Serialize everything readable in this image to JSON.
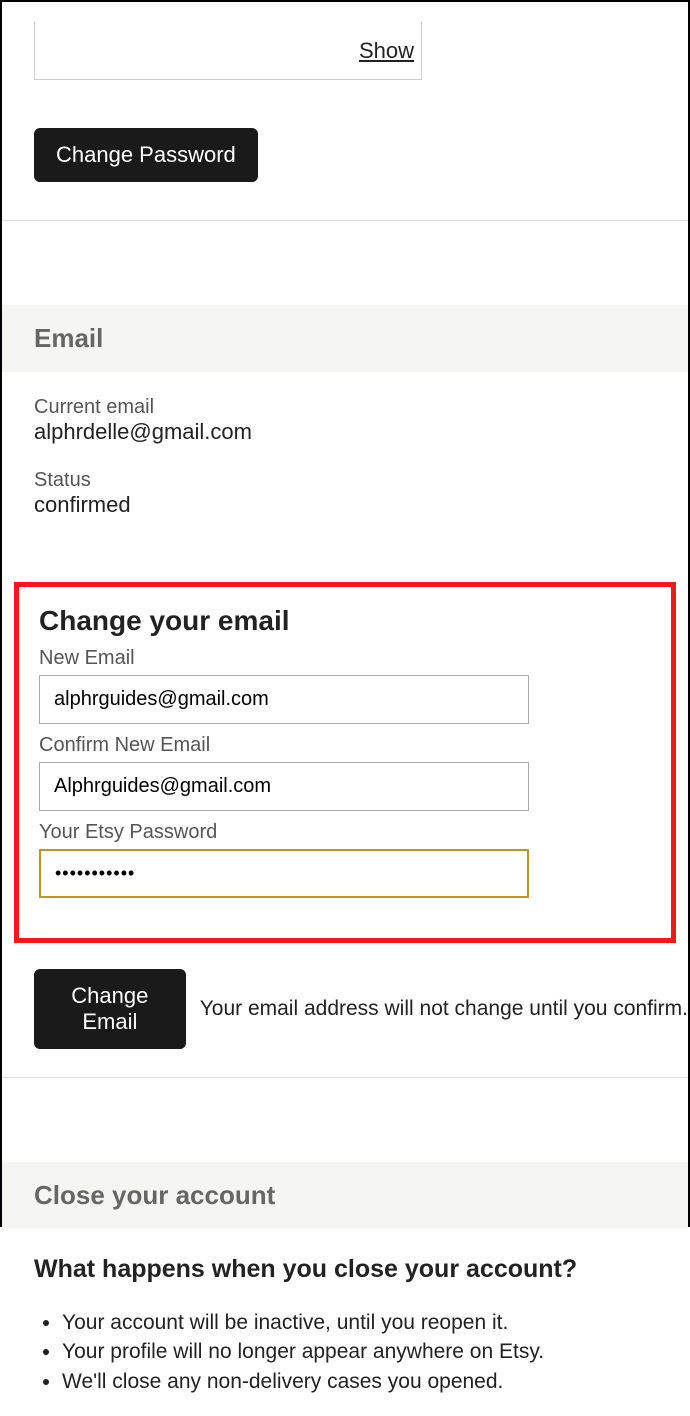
{
  "password_section": {
    "show_link": "Show",
    "change_button": "Change Password"
  },
  "email_section": {
    "header": "Email",
    "current_email_label": "Current email",
    "current_email_value": "alphrdelle@gmail.com",
    "status_label": "Status",
    "status_value": "confirmed",
    "change_title": "Change your email",
    "new_email_label": "New Email",
    "new_email_value": "alphrguides@gmail.com",
    "confirm_email_label": "Confirm New Email",
    "confirm_email_value": "Alphrguides@gmail.com",
    "etsy_password_label": "Your Etsy Password",
    "etsy_password_value": "•••••••••••",
    "change_email_button": "Change Email",
    "change_email_note": "Your email address will not change until you confirm."
  },
  "close_section": {
    "header": "Close your account",
    "subtitle": "What happens when you close your account?",
    "bullets": [
      "Your account will be inactive, until you reopen it.",
      "Your profile will no longer appear anywhere on Etsy.",
      "We'll close any non-delivery cases you opened."
    ]
  }
}
